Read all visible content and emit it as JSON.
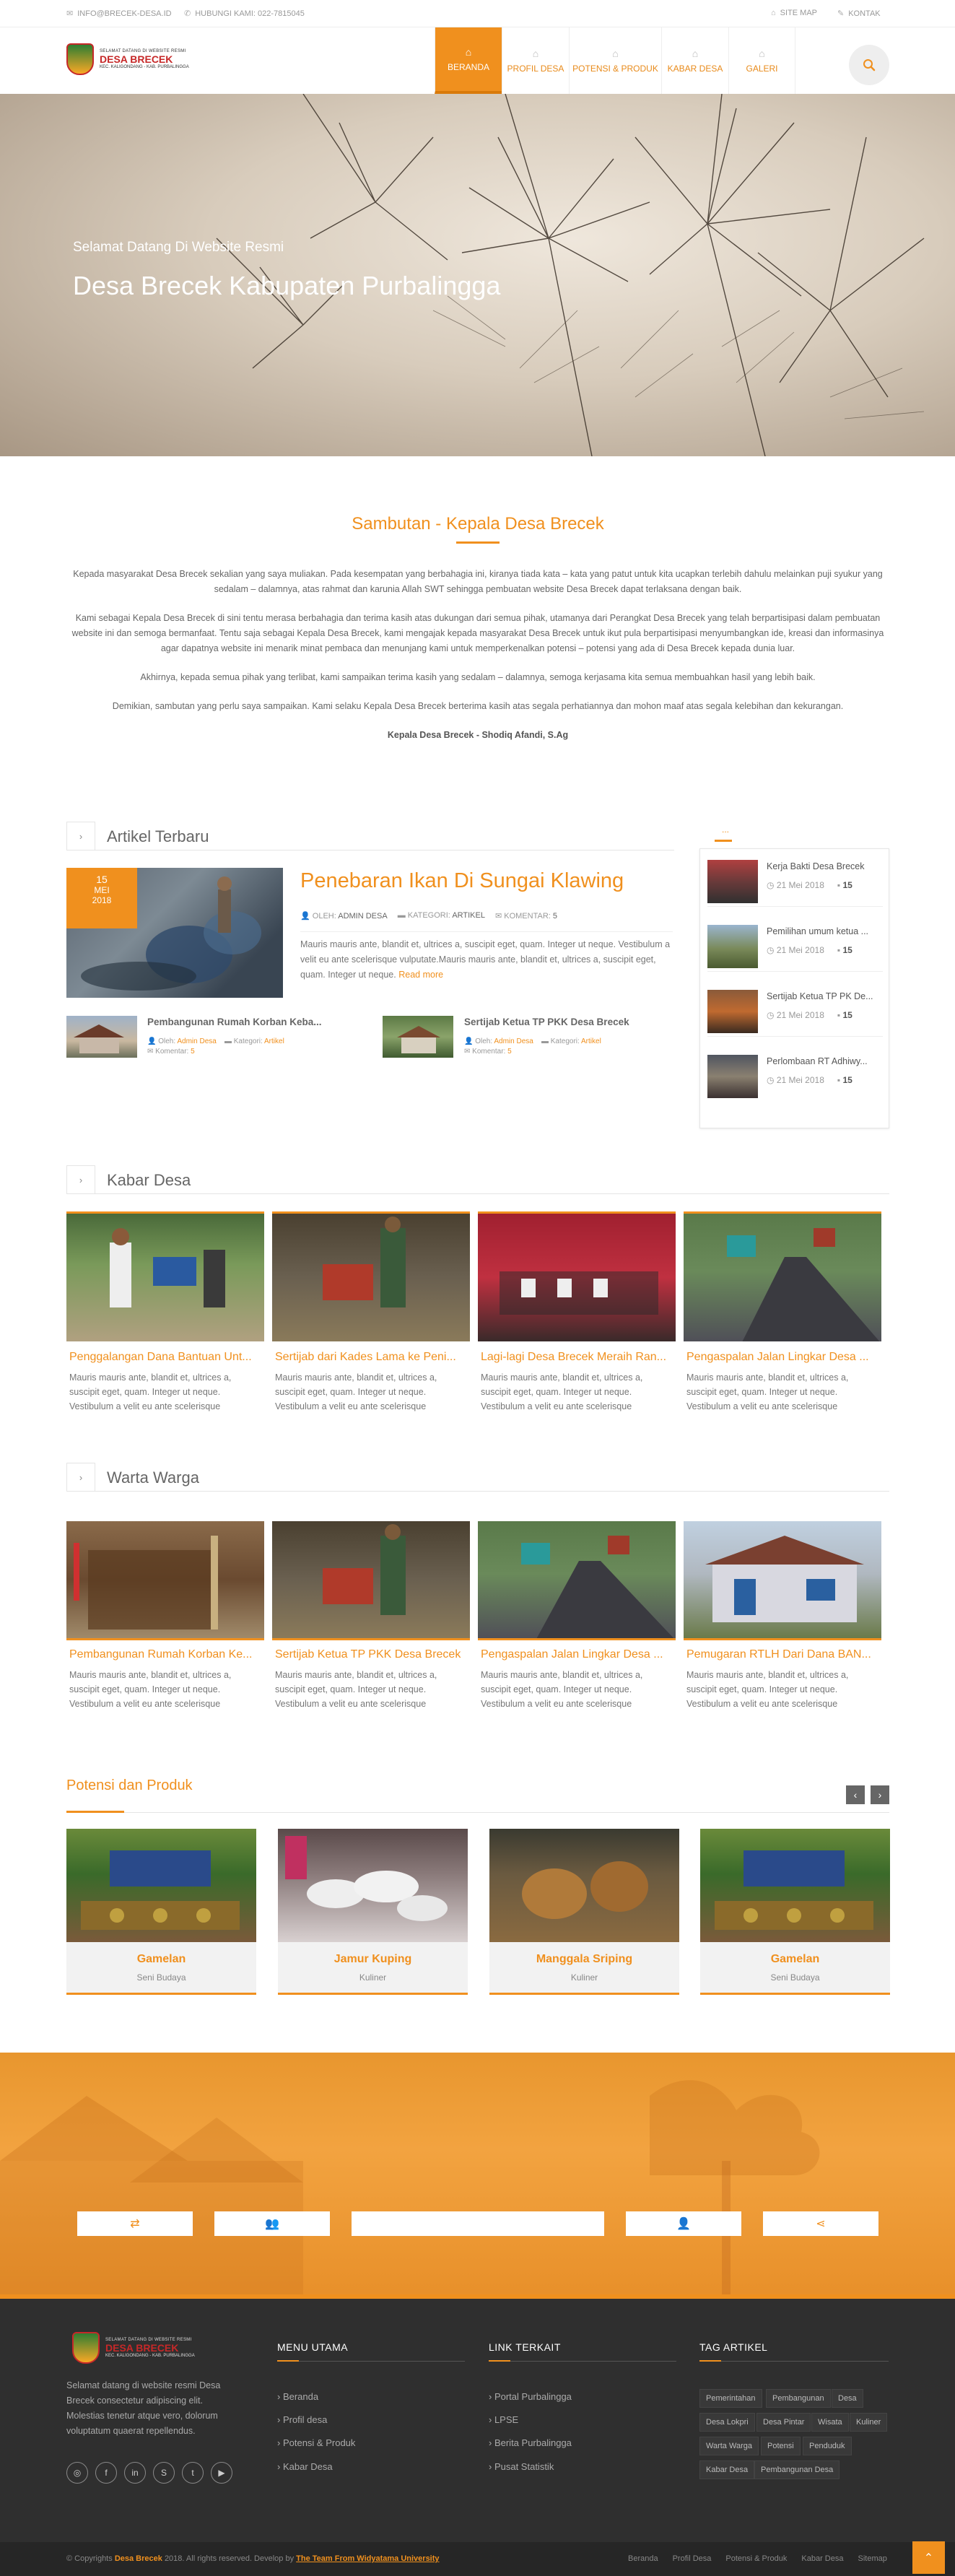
{
  "topbar": {
    "email": "INFO@BRECEK-DESA.ID",
    "phone": "HUBUNGI KAMI: 022-7815045",
    "sitemap": "SITE MAP",
    "kontak": "KONTAK"
  },
  "logo": {
    "line1": "SELAMAT DATANG DI WEBSITE RESMI",
    "line2": "DESA BRECEK",
    "line3": "KEC. KALIGONDANG - KAB. PURBALINGGA"
  },
  "nav": [
    {
      "label": "BERANDA",
      "icon": "home-icon",
      "active": true
    },
    {
      "label": "PROFIL DESA",
      "icon": "home-icon",
      "active": false
    },
    {
      "label": "POTENSI & PRODUK",
      "icon": "home-icon",
      "active": false
    },
    {
      "label": "KABAR DESA",
      "icon": "home-icon",
      "active": false
    },
    {
      "label": "GALERI",
      "icon": "home-icon",
      "active": false
    }
  ],
  "hero": {
    "subtitle": "Selamat Datang Di Website Resmi",
    "title": "Desa Brecek Kabupaten Purbalingga"
  },
  "sambutan": {
    "title": "Sambutan - Kepala Desa Brecek",
    "p1": "Kepada masyarakat Desa Brecek sekalian yang saya muliakan. Pada kesempatan yang berbahagia ini, kiranya tiada kata – kata yang patut untuk kita ucapkan terlebih dahulu melainkan puji syukur yang sedalam – dalamnya, atas rahmat dan karunia Allah SWT sehingga pembuatan website Desa Brecek dapat terlaksana dengan baik.",
    "p2": "Kami sebagai Kepala Desa Brecek di sini tentu merasa berbahagia dan terima kasih atas dukungan dari semua pihak, utamanya dari Perangkat Desa Brecek yang telah berpartisipasi dalam pembuatan website ini dan semoga bermanfaat. Tentu saja sebagai Kepala Desa Brecek, kami mengajak kepada masyarakat Desa Brecek untuk ikut pula berpartisipasi menyumbangkan ide, kreasi dan informasinya agar dapatnya website ini menarik minat pembaca dan menunjang kami untuk memperkenalkan potensi – potensi yang ada di Desa Brecek kepada dunia luar.",
    "p3": "Akhirnya, kepada semua pihak yang terlibat, kami sampaikan terima kasih yang sedalam – dalamnya, semoga kerjasama kita semua membuahkan hasil yang lebih baik.",
    "p4": "Demikian, sambutan yang perlu saya sampaikan. Kami selaku Kepala Desa Brecek berterima kasih atas segala perhatiannya dan mohon maaf atas segala kelebihan dan kekurangan.",
    "signature": "Kepala Desa Brecek - Shodiq Afandi, S.Ag"
  },
  "artikel": {
    "heading": "Artikel Terbaru",
    "featured": {
      "day": "15",
      "month": "MEI",
      "year": "2018",
      "title": "Penebaran Ikan Di Sungai Klawing",
      "oleh_label": "OLEH:",
      "oleh": "ADMIN DESA",
      "kategori_label": "KATEGORI:",
      "kategori": "ARTIKEL",
      "komentar_label": "KOMENTAR:",
      "komentar": "5",
      "excerpt": "Mauris mauris ante, blandit et, ultrices a, suscipit eget, quam. Integer ut neque. Vestibulum a velit eu ante scelerisque vulputate.Mauris mauris ante, blandit et, ultrices a, suscipit eget, quam. Integer ut neque.",
      "read_more": "Read more"
    },
    "small": [
      {
        "title": "Pembangunan Rumah Korban Keba...",
        "oleh_label": "Oleh:",
        "oleh": "Admin Desa",
        "kategori_label": "Kategori:",
        "kategori": "Artikel",
        "komentar_label": "Komentar:",
        "komentar": "5"
      },
      {
        "title": "Sertijab Ketua TP PKK Desa Brecek",
        "oleh_label": "Oleh:",
        "oleh": "Admin Desa",
        "kategori_label": "Kategori:",
        "kategori": "Artikel",
        "komentar_label": "Komentar:",
        "komentar": "5"
      }
    ],
    "sidebar_tab": "...",
    "sidebar": [
      {
        "title": "Kerja Bakti Desa Brecek",
        "date": "21 Mei 2018",
        "count": "15"
      },
      {
        "title": "Pemilihan umum ketua ...",
        "date": "21 Mei 2018",
        "count": "15"
      },
      {
        "title": "Sertijab Ketua TP PK De...",
        "date": "21 Mei 2018",
        "count": "15"
      },
      {
        "title": "Perlombaan RT Adhiwy...",
        "date": "21 Mei 2018",
        "count": "15"
      }
    ]
  },
  "kabar": {
    "heading": "Kabar Desa",
    "items": [
      {
        "title": "Penggalangan Dana Bantuan Unt...",
        "text": "Mauris mauris ante, blandit et, ultrices a, suscipit eget, quam. Integer ut neque. Vestibulum a velit eu ante scelerisque"
      },
      {
        "title": "Sertijab dari Kades Lama ke Peni...",
        "text": "Mauris mauris ante, blandit et, ultrices a, suscipit eget, quam. Integer ut neque. Vestibulum a velit eu ante scelerisque"
      },
      {
        "title": "Lagi-lagi Desa Brecek Meraih Ran...",
        "text": "Mauris mauris ante, blandit et, ultrices a, suscipit eget, quam. Integer ut neque. Vestibulum a velit eu ante scelerisque"
      },
      {
        "title": "Pengaspalan Jalan Lingkar Desa ...",
        "text": "Mauris mauris ante, blandit et, ultrices a, suscipit eget, quam. Integer ut neque. Vestibulum a velit eu ante scelerisque"
      }
    ]
  },
  "warta": {
    "heading": "Warta Warga",
    "items": [
      {
        "title": "Pembangunan Rumah Korban Ke...",
        "text": "Mauris mauris ante, blandit et, ultrices a, suscipit eget, quam. Integer ut neque. Vestibulum a velit eu ante scelerisque"
      },
      {
        "title": "Sertijab Ketua TP PKK Desa Brecek",
        "text": "Mauris mauris ante, blandit et, ultrices a, suscipit eget, quam. Integer ut neque. Vestibulum a velit eu ante scelerisque"
      },
      {
        "title": "Pengaspalan Jalan Lingkar Desa ...",
        "text": "Mauris mauris ante, blandit et, ultrices a, suscipit eget, quam. Integer ut neque. Vestibulum a velit eu ante scelerisque"
      },
      {
        "title": "Pemugaran RTLH Dari Dana BAN...",
        "text": "Mauris mauris ante, blandit et, ultrices a, suscipit eget, quam. Integer ut neque. Vestibulum a velit eu ante scelerisque"
      }
    ]
  },
  "potensi": {
    "heading": "Potensi dan Produk",
    "items": [
      {
        "name": "Gamelan",
        "category": "Seni Budaya"
      },
      {
        "name": "Jamur Kuping",
        "category": "Kuliner"
      },
      {
        "name": "Manggala Sriping",
        "category": "Kuliner"
      },
      {
        "name": "Gamelan",
        "category": "Seni Budaya"
      }
    ]
  },
  "footer": {
    "about": "Selamat datang di website resmi Desa Brecek consectetur adipiscing elit. Molestias tenetur atque vero, dolorum voluptatum quaerat repellendus.",
    "menu_heading": "MENU UTAMA",
    "menu": [
      "Beranda",
      "Profil desa",
      "Potensi & Produk",
      "Kabar Desa"
    ],
    "link_heading": "LINK TERKAIT",
    "links": [
      "Portal Purbalingga",
      "LPSE",
      "Berita Purbalingga",
      "Pusat Statistik"
    ],
    "tag_heading": "TAG ARTIKEL",
    "tags": [
      "Pemerintahan",
      "Pembangunan",
      "Desa",
      "Desa Lokpri",
      "Desa Pintar",
      "Wisata",
      "Kuliner",
      "Warta Warga",
      "Potensi",
      "Penduduk",
      "Kabar Desa",
      "Pembangunan Desa"
    ]
  },
  "copyright": {
    "prefix": "© Copyrights",
    "brand": "Desa Brecek",
    "middle": "2018. All rights reserved. Develop by",
    "developer": "The Team From Widyatama University",
    "links": [
      "Beranda",
      "Profil Desa",
      "Potensi & Produk",
      "Kabar Desa",
      "Sitemap"
    ]
  },
  "colors": {
    "accent": "#f0901e",
    "footer_bg": "#2f2f2f"
  }
}
